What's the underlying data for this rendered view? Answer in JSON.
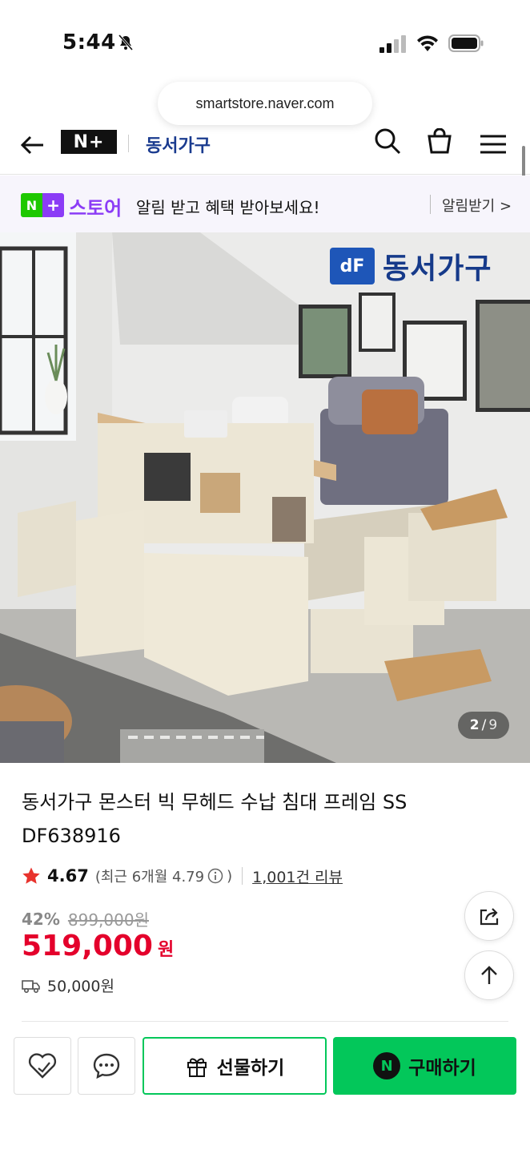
{
  "status_bar": {
    "time": "5:44"
  },
  "browser": {
    "url": "smartstore.naver.com"
  },
  "header": {
    "np_logo": "N+",
    "brand_name": "동서가구"
  },
  "notice": {
    "n_label": "N",
    "plus_label": "+",
    "store_label": "스토어",
    "message": "알림 받고 혜택 받아보세요!",
    "action": "알림받기 >"
  },
  "gallery": {
    "logo_mark": "dF",
    "logo_text": "동서가구",
    "current": "2",
    "separator": "/",
    "total": "9"
  },
  "product": {
    "title_line1": "동서가구 몬스터 빅 무헤드 수납 침대 프레임 SS",
    "title_line2": "DF638916",
    "rating": "4.67",
    "recent_prefix": "(최근 6개월 4.79",
    "recent_suffix": ")",
    "review_count": "1,001건 리뷰",
    "discount_rate": "42%",
    "original_price": "899,000원",
    "sale_price": "519,000",
    "sale_unit": "원",
    "shipping_fee": "50,000원"
  },
  "actions": {
    "gift_label": "선물하기",
    "buy_label": "구매하기",
    "npay_letter": "N"
  },
  "colors": {
    "naver_green": "#03c75a",
    "store_purple": "#8b3cf6",
    "price_red": "#e4002b"
  }
}
